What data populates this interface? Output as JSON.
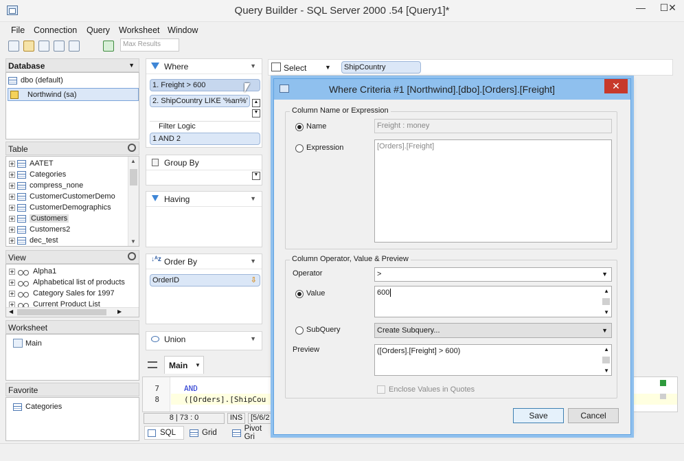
{
  "window": {
    "title": "Query Builder - SQL Server 2000 .54 [Query1]*",
    "minimize": "—",
    "maximize": "☐",
    "close": "✕"
  },
  "menu": [
    "File",
    "Connection",
    "Query",
    "Worksheet",
    "Window"
  ],
  "toolbar": {
    "max_results_placeholder": "Max Results"
  },
  "database": {
    "header": "Database",
    "items": [
      "dbo (default)",
      "Northwind (sa)"
    ]
  },
  "table_panel": {
    "header": "Table",
    "items": [
      "AATET",
      "Categories",
      "compress_none",
      "CustomerCustomerDemo",
      "CustomerDemographics",
      "Customers",
      "Customers2",
      "dec_test"
    ]
  },
  "view_panel": {
    "header": "View",
    "items": [
      "Alpha1",
      "Alphabetical list of products",
      "Category Sales for 1997",
      "Current Product List"
    ]
  },
  "worksheet_panel": {
    "header": "Worksheet",
    "items": [
      "Main"
    ]
  },
  "favorite_panel": {
    "header": "Favorite",
    "items": [
      "Categories"
    ]
  },
  "where": {
    "header": "Where",
    "criteria": [
      "1. Freight > 600",
      "2. ShipCountry LIKE '%an%'"
    ],
    "filter_logic_label": "Filter Logic",
    "filter_logic_value": "1 AND 2"
  },
  "group_by": {
    "header": "Group By"
  },
  "having": {
    "header": "Having"
  },
  "order_by": {
    "header": "Order By",
    "items": [
      "OrderID"
    ]
  },
  "union": {
    "header": "Union"
  },
  "select": {
    "label": "Select",
    "columns": [
      "ShipCountry"
    ]
  },
  "editor": {
    "tab": "Main",
    "lines": [
      {
        "num": "7",
        "text": "AND"
      },
      {
        "num": "8",
        "text": "([Orders].[ShipCou"
      }
    ],
    "status": {
      "position": "8 | 73 : 0",
      "mode": "INS",
      "date": "[5/6/2"
    }
  },
  "bottom_tabs": [
    "SQL",
    "Grid",
    "Pivot Gri"
  ],
  "dialog": {
    "title": "Where Criteria #1 [Northwind].[dbo].[Orders].[Freight]",
    "close": "✕",
    "group1_label": "Column Name or Expression",
    "name_label": "Name",
    "name_value": "Freight : money",
    "expression_label": "Expression",
    "expression_value": "[Orders].[Freight]",
    "group2_label": "Column Operator, Value & Preview",
    "operator_label": "Operator",
    "operator_value": ">",
    "value_label": "Value",
    "value_value": "600",
    "subquery_label": "SubQuery",
    "subquery_value": "Create Subquery...",
    "preview_label": "Preview",
    "preview_value": "([Orders].[Freight] > 600)",
    "enclose_label": "Enclose Values in Quotes",
    "save": "Save",
    "cancel": "Cancel"
  }
}
